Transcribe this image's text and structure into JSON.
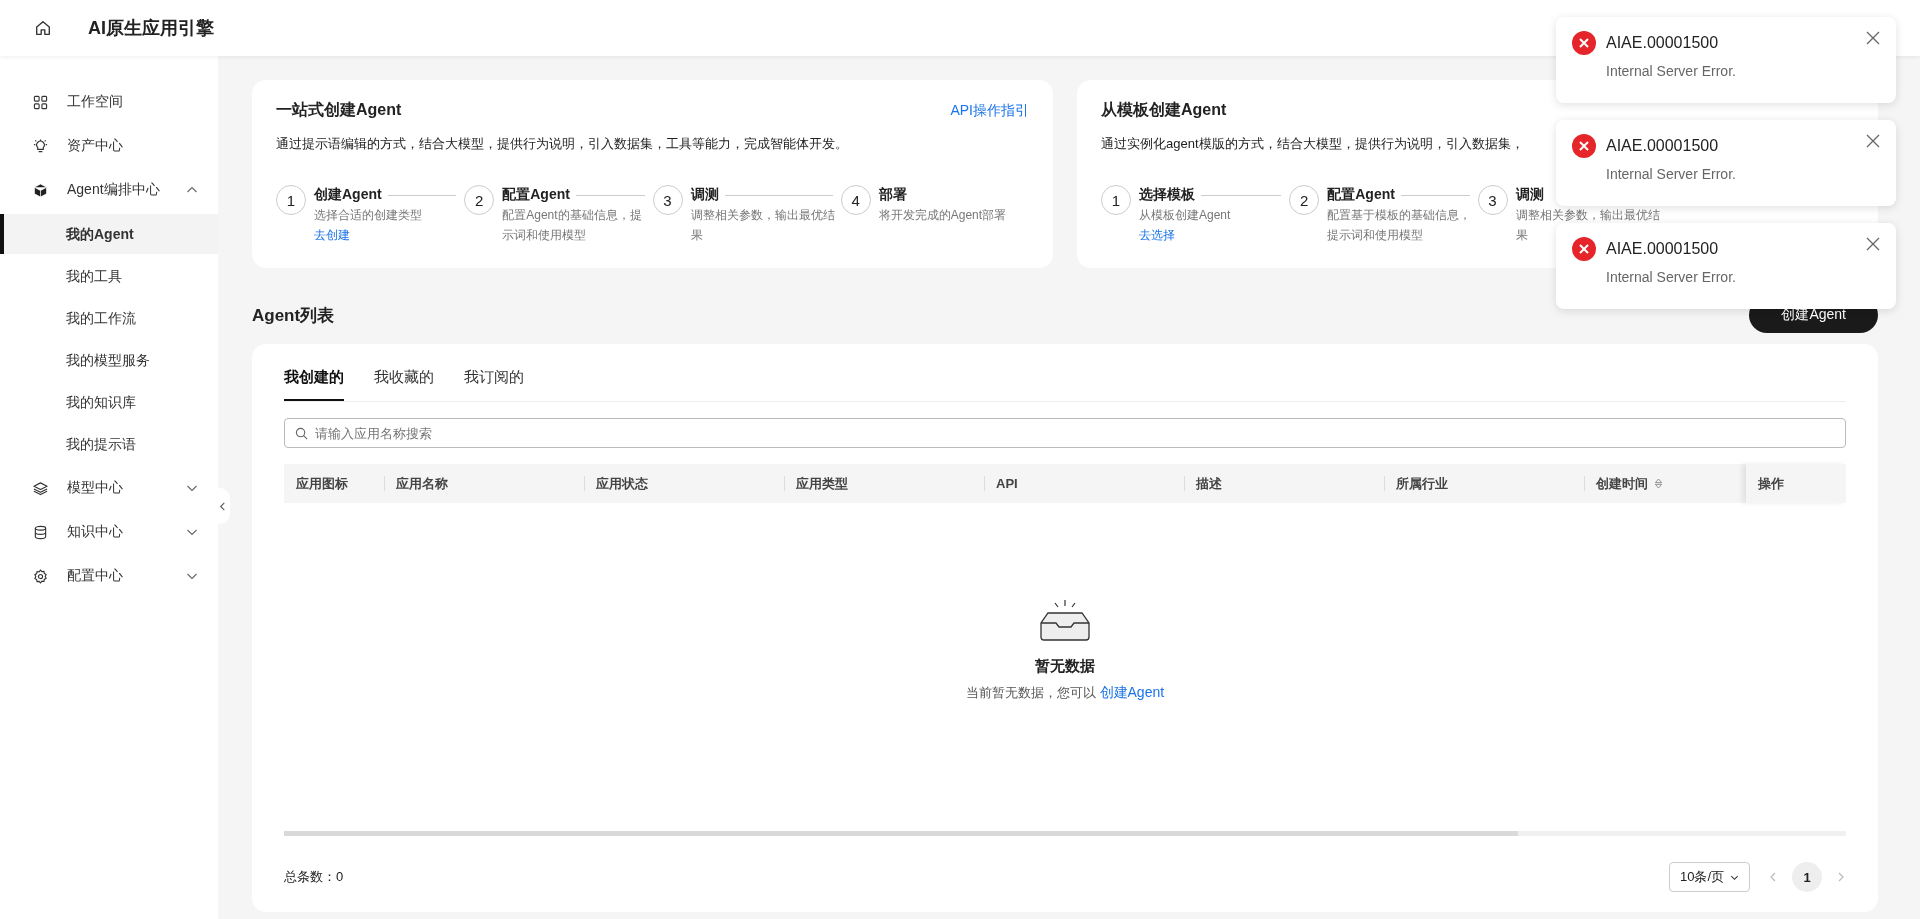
{
  "header": {
    "title": "AI原生应用引擎"
  },
  "sidebar": {
    "items": [
      {
        "label": "工作空间"
      },
      {
        "label": "资产中心"
      },
      {
        "label": "Agent编排中心",
        "expanded": true,
        "children": [
          {
            "label": "我的Agent",
            "selected": true
          },
          {
            "label": "我的工具",
            "selected": false
          },
          {
            "label": "我的工作流",
            "selected": false
          },
          {
            "label": "我的模型服务",
            "selected": false
          },
          {
            "label": "我的知识库",
            "selected": false
          },
          {
            "label": "我的提示语",
            "selected": false
          }
        ]
      },
      {
        "label": "模型中心",
        "expanded": false
      },
      {
        "label": "知识中心",
        "expanded": false
      },
      {
        "label": "配置中心",
        "expanded": false
      }
    ]
  },
  "cards": [
    {
      "title": "一站式创建Agent",
      "link": "API操作指引",
      "description": "通过提示语编辑的方式，结合大模型，提供行为说明，引入数据集，工具等能力，完成智能体开发。",
      "steps": [
        {
          "number": "1",
          "title": "创建Agent",
          "description": "选择合适的创建类型",
          "action": "去创建"
        },
        {
          "number": "2",
          "title": "配置Agent",
          "description": "配置Agent的基础信息，提示词和使用模型"
        },
        {
          "number": "3",
          "title": "调测",
          "description": "调整相关参数，输出最优结果"
        },
        {
          "number": "4",
          "title": "部署",
          "description": "将开发完成的Agent部署"
        }
      ]
    },
    {
      "title": "从模板创建Agent",
      "description": "通过实例化agent模版的方式，结合大模型，提供行为说明，引入数据集，",
      "steps": [
        {
          "number": "1",
          "title": "选择模板",
          "description": "从模板创建Agent",
          "action": "去选择"
        },
        {
          "number": "2",
          "title": "配置Agent",
          "description": "配置基于模板的基础信息，提示词和使用模型"
        },
        {
          "number": "3",
          "title": "调测",
          "description": "调整相关参数，输出最优结果"
        }
      ]
    }
  ],
  "list": {
    "title": "Agent列表",
    "create_button": "创建Agent",
    "tabs": [
      {
        "label": "我创建的",
        "selected": true
      },
      {
        "label": "我收藏的",
        "selected": false
      },
      {
        "label": "我订阅的",
        "selected": false
      }
    ],
    "search": {
      "placeholder": "请输入应用名称搜索"
    },
    "table": {
      "columns": [
        {
          "label": "应用图标"
        },
        {
          "label": "应用名称"
        },
        {
          "label": "应用状态"
        },
        {
          "label": "应用类型"
        },
        {
          "label": "API"
        },
        {
          "label": "描述"
        },
        {
          "label": "所属行业"
        },
        {
          "label": "创建时间",
          "sortable": true
        },
        {
          "label": "操作"
        }
      ]
    },
    "empty": {
      "title": "暂无数据",
      "text": "当前暂无数据，您可以",
      "link": "创建Agent"
    },
    "total": "总条数：0",
    "page_size": "10条/页",
    "pages": [
      {
        "label": "1",
        "selected": true
      }
    ]
  },
  "toasts": [
    {
      "title": "AIAE.00001500",
      "message": "Internal Server Error."
    },
    {
      "title": "AIAE.00001500",
      "message": "Internal Server Error."
    },
    {
      "title": "AIAE.00001500",
      "message": "Internal Server Error."
    }
  ]
}
